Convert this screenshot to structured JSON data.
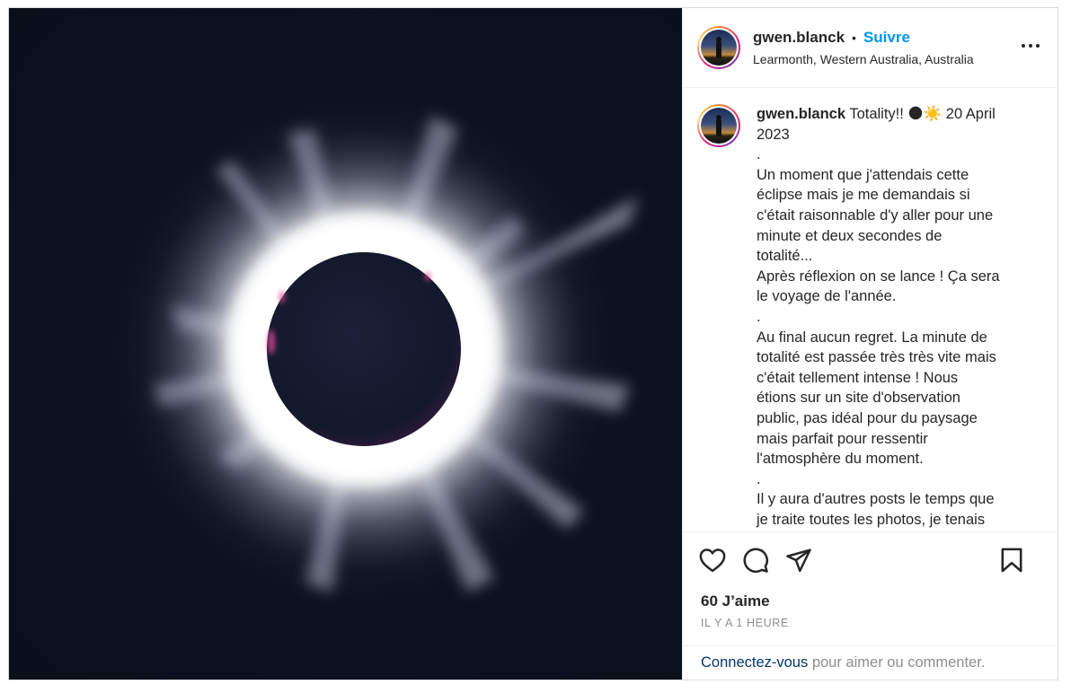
{
  "post": {
    "username": "gwen.blanck",
    "separator": "•",
    "follow_label": "Suivre",
    "location": "Learmonth, Western Australia, Australia",
    "image_alt": "Total solar eclipse with corona"
  },
  "caption": {
    "username": "gwen.blanck",
    "lines": [
      "Totality!! 🌑☀️ 20 April",
      "2023",
      ".",
      "Un moment que j'attendais cette",
      "éclipse mais je me demandais si",
      "c'était raisonnable d'y aller pour une",
      "minute et deux secondes de",
      "totalité...",
      "Après réflexion on se lance ! Ça sera",
      "le voyage de l'année.",
      ".",
      "Au final aucun regret. La minute de",
      "totalité est passée très très vite mais",
      "c'était tellement intense ! Nous",
      "étions sur un site d'observation",
      "public, pas idéal pour du paysage",
      "mais parfait pour ressentir",
      "l'atmosphère du moment.",
      ".",
      "Il y aura d'autres posts le temps que",
      "je traite toutes les photos, je tenais"
    ]
  },
  "actions": {
    "like_icon": "heart-icon",
    "comment_icon": "comment-icon",
    "share_icon": "paper-plane-icon",
    "save_icon": "bookmark-icon"
  },
  "stats": {
    "likes": "60 J’aime",
    "timestamp": "IL Y A 1 HEURE"
  },
  "login_prompt": {
    "link": "Connectez-vous",
    "text": " pour aimer ou commenter."
  },
  "colors": {
    "accent": "#0095f6",
    "link_dark": "#00376b",
    "muted": "#8e8e8e",
    "border": "#dbdbdb"
  }
}
